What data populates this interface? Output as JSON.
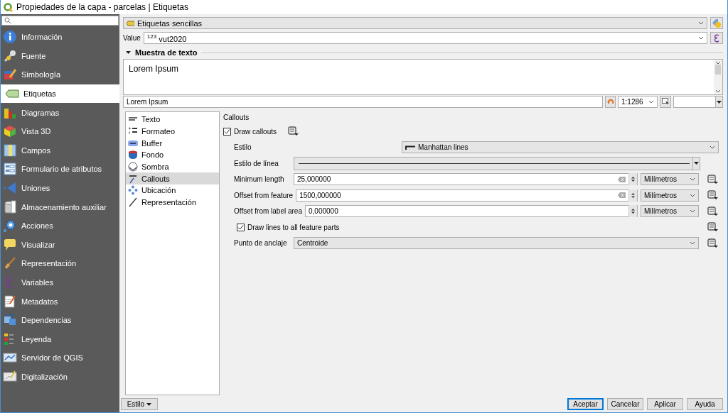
{
  "window": {
    "title": "Propiedades de la capa - parcelas | Etiquetas"
  },
  "sidebar": {
    "items": [
      {
        "label": "Información",
        "selected": false
      },
      {
        "label": "Fuente",
        "selected": false
      },
      {
        "label": "Simbología",
        "selected": false
      },
      {
        "label": "Etiquetas",
        "selected": true
      },
      {
        "label": "Diagramas",
        "selected": false
      },
      {
        "label": "Vista 3D",
        "selected": false
      },
      {
        "label": "Campos",
        "selected": false
      },
      {
        "label": "Formulario de atributos",
        "selected": false
      },
      {
        "label": "Uniones",
        "selected": false
      },
      {
        "label": "Almacenamiento auxiliar",
        "selected": false
      },
      {
        "label": "Acciones",
        "selected": false
      },
      {
        "label": "Visualizar",
        "selected": false
      },
      {
        "label": "Representación",
        "selected": false
      },
      {
        "label": "Variables",
        "selected": false
      },
      {
        "label": "Metadatos",
        "selected": false
      },
      {
        "label": "Dependencias",
        "selected": false
      },
      {
        "label": "Leyenda",
        "selected": false
      },
      {
        "label": "Servidor de QGIS",
        "selected": false
      },
      {
        "label": "Digitalización",
        "selected": false
      }
    ]
  },
  "mode": {
    "value": "Etiquetas sencillas"
  },
  "value_field": {
    "label": "Value",
    "prefix": "123",
    "value": "vut2020"
  },
  "sample": {
    "title": "Muestra de texto",
    "expanded": true,
    "text": "Lorem Ipsum",
    "preview_text": "Lorem Ipsum",
    "scale": "1:1286"
  },
  "tabs": [
    {
      "label": "Texto",
      "selected": false
    },
    {
      "label": "Formateo",
      "selected": false
    },
    {
      "label": "Buffer",
      "selected": false
    },
    {
      "label": "Fondo",
      "selected": false
    },
    {
      "label": "Sombra",
      "selected": false
    },
    {
      "label": "Callouts",
      "selected": true
    },
    {
      "label": "Ubicación",
      "selected": false
    },
    {
      "label": "Representación",
      "selected": false
    }
  ],
  "callouts": {
    "title": "Callouts",
    "draw_callouts": {
      "label": "Draw callouts",
      "checked": true
    },
    "rows": [
      {
        "kind": "style",
        "label": "Estilo",
        "value": "Manhattan lines"
      },
      {
        "kind": "line",
        "label": "Estilo de línea"
      },
      {
        "kind": "number",
        "label": "Minimum length",
        "value": "25,000000",
        "clearable": true,
        "unit": "Milímetros"
      },
      {
        "kind": "number",
        "label": "Offset from feature",
        "value": "1500,000000",
        "clearable": true,
        "unit": "Milímetros"
      },
      {
        "kind": "number",
        "label": "Offset from label area",
        "value": "0,000000",
        "clearable": false,
        "unit": "Milímetros"
      },
      {
        "kind": "checkbox",
        "label": "Draw lines to all feature parts",
        "checked": true
      },
      {
        "kind": "combo",
        "label": "Punto de anclaje",
        "value": "Centroide"
      }
    ]
  },
  "style_button": {
    "label": "Estilo"
  },
  "buttons": [
    {
      "label": "Aceptar",
      "default": true
    },
    {
      "label": "Cancelar",
      "default": false
    },
    {
      "label": "Aplicar",
      "default": false
    },
    {
      "label": "Ayuda",
      "default": false
    }
  ]
}
